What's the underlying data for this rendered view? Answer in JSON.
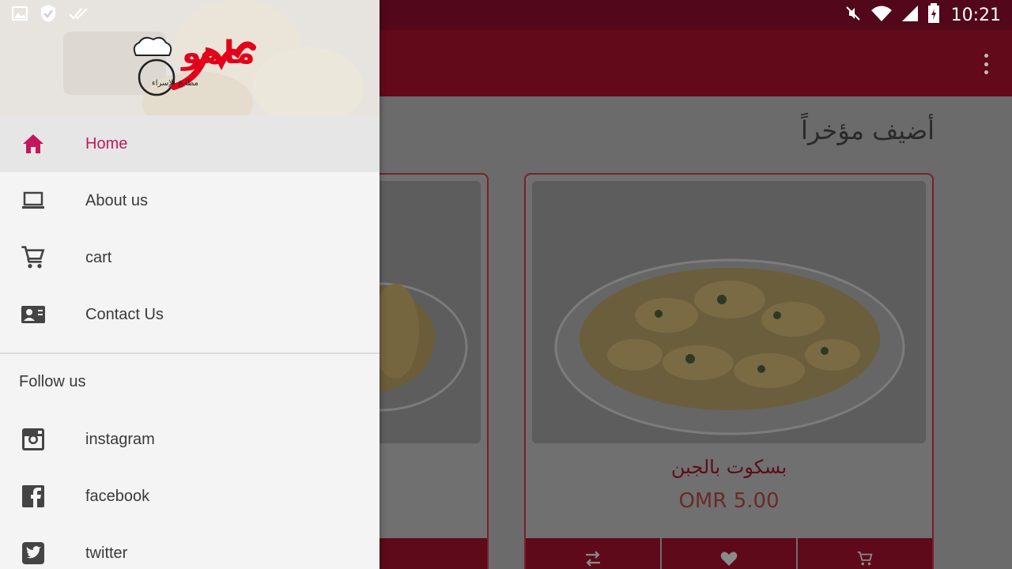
{
  "status_bar": {
    "time": "10:21",
    "left_icons": [
      "image-icon",
      "shield-check-icon",
      "double-check-icon"
    ],
    "right_icons": [
      "mute-icon",
      "wifi-icon",
      "signal-icon",
      "battery-icon"
    ]
  },
  "app_bar": {
    "menu_icon": "more-vert-icon"
  },
  "content": {
    "section_title": "أضيف مؤخراً",
    "products": [
      {
        "name": "",
        "price": "",
        "image_icon": "cookie-plate-image"
      },
      {
        "name": "بسكوت بالجبن",
        "price": "OMR 5.00",
        "image_icon": "cheese-biscuits-image"
      }
    ],
    "card_actions": [
      "compare-icon",
      "favorite-icon",
      "cart-icon"
    ]
  },
  "drawer": {
    "logo_text": "ماهو",
    "logo_subtext": "مطابخ الإسراء",
    "nav_items": [
      {
        "label": "Home",
        "icon": "home-icon",
        "active": true
      },
      {
        "label": "About us",
        "icon": "laptop-icon",
        "active": false
      },
      {
        "label": "cart",
        "icon": "cart-icon",
        "active": false
      },
      {
        "label": "Contact Us",
        "icon": "contact-card-icon",
        "active": false
      }
    ],
    "follow_title": "Follow us",
    "social_items": [
      {
        "label": "instagram",
        "icon": "instagram-icon"
      },
      {
        "label": "facebook",
        "icon": "facebook-icon"
      },
      {
        "label": "twitter",
        "icon": "twitter-icon"
      }
    ]
  },
  "colors": {
    "status_bar": "#52081a",
    "app_bar": "#62091a",
    "accent": "#c2185b",
    "brand_red": "#e3001b"
  }
}
